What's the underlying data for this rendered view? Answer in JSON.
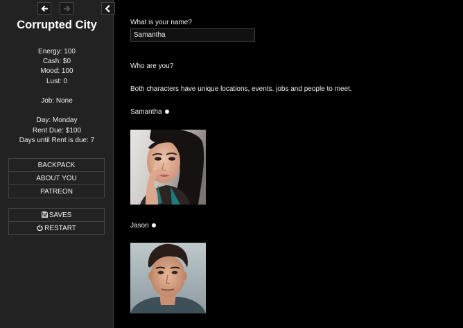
{
  "sidebar": {
    "story_title": "Corrupted City",
    "stats": {
      "energy": "Energy: 100",
      "cash": "Cash: $0",
      "mood": "Mood: 100",
      "lust": "Lust: 0",
      "job": "Job: None",
      "day": "Day: Monday",
      "rent_due": "Rent Due: $100",
      "days_until_rent": "Days until Rent is due: 7"
    },
    "menu": [
      {
        "label": "BACKPACK"
      },
      {
        "label": "ABOUT YOU"
      },
      {
        "label": "PATREON"
      }
    ],
    "saves_label": "SAVES",
    "restart_label": "RESTART"
  },
  "main": {
    "name_question": "What is your name?",
    "name_value": "Samantha",
    "who_question": "Who are you?",
    "description": "Both characters have unique locations, events. jobs and people to meet.",
    "characters": [
      {
        "name": "Samantha"
      },
      {
        "name": "Jason"
      }
    ]
  },
  "icons": {
    "back": "arrow-left-icon",
    "forward": "arrow-right-icon",
    "collapse": "chevron-left-icon",
    "saves": "floppy-disk-icon",
    "restart": "power-icon"
  }
}
